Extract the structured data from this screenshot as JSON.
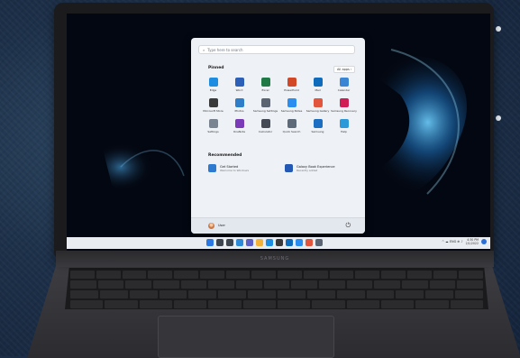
{
  "device": {
    "brand": "SAMSUNG"
  },
  "start_menu": {
    "search_placeholder": "Type here to search",
    "pinned_title": "Pinned",
    "all_apps_label": "All apps  ›",
    "pinned": [
      {
        "label": "Edge",
        "color": "#1c8de0",
        "icon": "edge-icon"
      },
      {
        "label": "Word",
        "color": "#2b5fb8",
        "icon": "word-icon"
      },
      {
        "label": "Excel",
        "color": "#1f7a45",
        "icon": "excel-icon"
      },
      {
        "label": "PowerPoint",
        "color": "#d24726",
        "icon": "powerpoint-icon"
      },
      {
        "label": "Mail",
        "color": "#0f6cbd",
        "icon": "mail-icon"
      },
      {
        "label": "Calendar",
        "color": "#3a86d4",
        "icon": "calendar-icon"
      },
      {
        "label": "Microsoft Store",
        "color": "#3a3a3a",
        "icon": "store-icon"
      },
      {
        "label": "Photos",
        "color": "#2d7dc8",
        "icon": "photos-icon"
      },
      {
        "label": "Samsung Settings",
        "color": "#5a6472",
        "icon": "settings-gear-icon"
      },
      {
        "label": "Samsung Notes",
        "color": "#2a8ef0",
        "icon": "notes-icon"
      },
      {
        "label": "Samsung Gallery",
        "color": "#e2543b",
        "icon": "gallery-icon"
      },
      {
        "label": "Samsung Recovery",
        "color": "#d11b57",
        "icon": "recovery-icon"
      },
      {
        "label": "Settings",
        "color": "#7a8390",
        "icon": "gear-icon"
      },
      {
        "label": "OneNote",
        "color": "#7b3ab8",
        "icon": "onenote-icon"
      },
      {
        "label": "Calculator",
        "color": "#444b55",
        "icon": "calculator-icon"
      },
      {
        "label": "Quick Search",
        "color": "#5d6a7a",
        "icon": "quick-search-icon"
      },
      {
        "label": "Samsung",
        "color": "#1b6ec2",
        "icon": "samsung-icon"
      },
      {
        "label": "Help",
        "color": "#2a9bd8",
        "icon": "help-icon"
      }
    ],
    "recommended_title": "Recommended",
    "recommended": [
      {
        "name": "Get Started",
        "sub": "Welcome to Windows",
        "color": "#2e7ad1",
        "icon": "get-started-icon"
      },
      {
        "name": "Galaxy Book Experience",
        "sub": "Recently added",
        "color": "#2458b5",
        "icon": "galaxy-book-icon"
      }
    ],
    "user_name": "User"
  },
  "taskbar": {
    "icons": [
      {
        "name": "start",
        "color": "#2b78e4"
      },
      {
        "name": "search",
        "color": "#3d4550"
      },
      {
        "name": "task-view",
        "color": "#3d4550"
      },
      {
        "name": "widgets",
        "color": "#2d8ad8"
      },
      {
        "name": "chat",
        "color": "#5b5fc7"
      },
      {
        "name": "file-explorer",
        "color": "#f2b23a"
      },
      {
        "name": "edge",
        "color": "#1c8de0"
      },
      {
        "name": "store",
        "color": "#3a3a3a"
      },
      {
        "name": "mail",
        "color": "#0f6cbd"
      },
      {
        "name": "samsung-notes",
        "color": "#2a8ef0"
      },
      {
        "name": "gallery",
        "color": "#e2543b"
      },
      {
        "name": "samsung-settings",
        "color": "#5a6472"
      }
    ],
    "tray_text": "^  ☁  ENG  ⊕  ♪",
    "time": "4:30 PM",
    "date": "2/1/2022"
  }
}
